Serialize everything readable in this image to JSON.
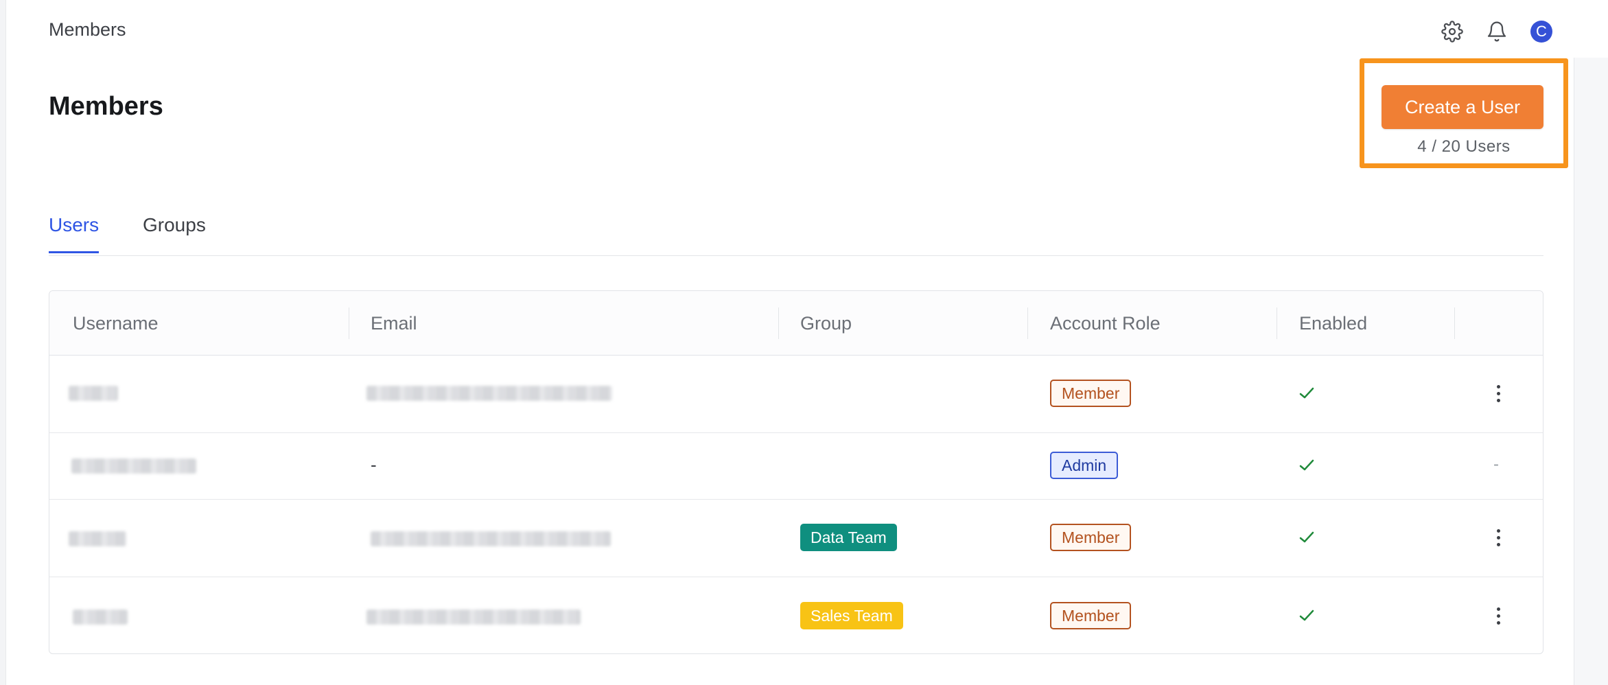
{
  "topbar": {
    "title": "Members",
    "avatar_initial": "C"
  },
  "icons": {
    "settings": "gear-icon",
    "notifications": "bell-icon",
    "enabled": "check-icon",
    "row_actions": "kebab-menu-icon"
  },
  "page": {
    "title": "Members"
  },
  "create_user": {
    "label": "Create a User",
    "count": "4 / 20 Users"
  },
  "tabs": [
    {
      "label": "Users",
      "active": true
    },
    {
      "label": "Groups",
      "active": false
    }
  ],
  "table": {
    "columns": [
      "Username",
      "Email",
      "Group",
      "Account Role",
      "Enabled"
    ],
    "rows": [
      {
        "username": "",
        "email": "",
        "group": "",
        "role": "Member",
        "enabled": true,
        "actions": "menu"
      },
      {
        "username": "",
        "email": "-",
        "group": "",
        "role": "Admin",
        "enabled": true,
        "actions": "-"
      },
      {
        "username": "",
        "email": "",
        "group": "Data Team",
        "role": "Member",
        "enabled": true,
        "actions": "menu"
      },
      {
        "username": "",
        "email": "",
        "group": "Sales Team",
        "role": "Member",
        "enabled": true,
        "actions": "menu"
      }
    ]
  },
  "colors": {
    "accent_blue": "#2f55e4",
    "create_button": "#f07f34",
    "highlight": "#f7941d",
    "member_badge": "#b3521f",
    "admin_badge": "#3b5bd6",
    "data_team": "#0f8f7f",
    "sales_team": "#f8c315",
    "check": "#1f8a3a"
  }
}
